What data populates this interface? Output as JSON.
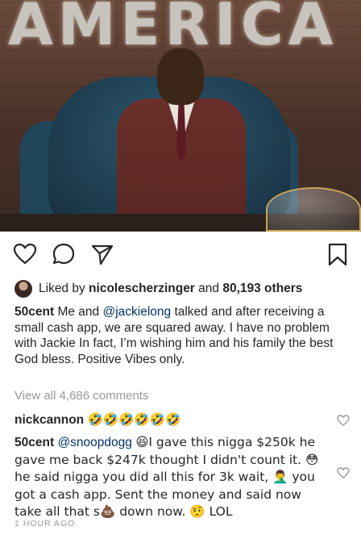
{
  "photo": {
    "sign_text": "AMERICA"
  },
  "actions": {
    "like_icon": "heart-outline-icon",
    "comment_icon": "comment-bubble-icon",
    "share_icon": "paper-plane-icon",
    "save_icon": "bookmark-icon"
  },
  "likes": {
    "prefix": "Liked by",
    "user": "nicolescherzinger",
    "and": "and",
    "count": "80,193 others"
  },
  "caption": {
    "user": "50cent",
    "text_before_mention": "Me and",
    "mention": "@jackielong",
    "text_after_mention": "talked and after receiving a small cash app, we are squared away. I have no problem with Jackie In fact, I’m wishing him and his family the best God bless. Positive Vibes only."
  },
  "view_all": "View all 4,686 comments",
  "comments": [
    {
      "user": "nickcannon",
      "text": "🤣🤣🤣🤣🤣🤣"
    },
    {
      "user": "50cent",
      "mention": "@snoopdogg",
      "text": "😆I gave this nigga $250k he gave me back $247k  thought I didn't count it. 😳he said nigga you did all this for 3k wait, 🤦‍♂️ you got a cash app. Sent the money and said now take all that s💩 down now. 🤨 LOL"
    }
  ],
  "timestamp": "1 HOUR AGO",
  "colors": {
    "text": "#262626",
    "mention": "#003569",
    "muted": "#999999"
  }
}
